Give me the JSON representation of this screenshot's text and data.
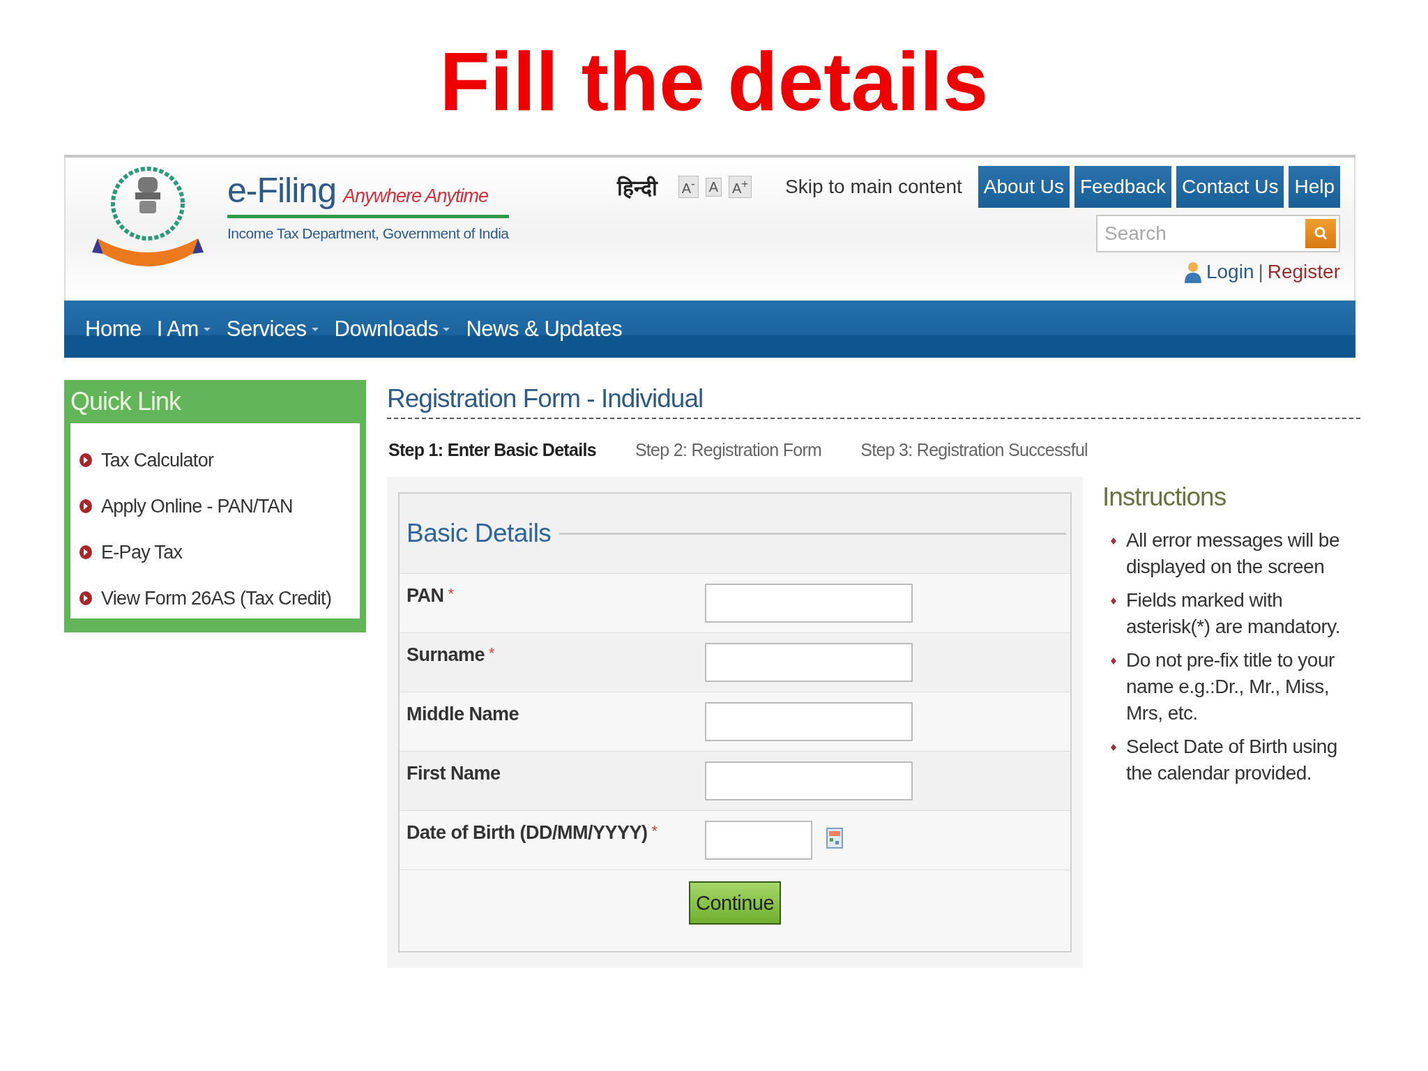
{
  "slide_title": "Fill the details",
  "header": {
    "logo_title": "e-Filing",
    "tagline": "Anywhere Anytime",
    "subtitle": "Income Tax Department, Government of India",
    "language_link": "हिन्दी",
    "font_size_buttons": [
      "A$^{-}$",
      "A",
      "A$^{+}$"
    ],
    "skip_link": "Skip to main content",
    "top_buttons": [
      "About Us",
      "Feedback",
      "Contact Us",
      "Help"
    ],
    "search": {
      "placeholder": "Search"
    },
    "account": {
      "login": "Login",
      "separator": "|",
      "register": "Register"
    }
  },
  "nav": [
    {
      "label": "Home",
      "has_menu": false
    },
    {
      "label": "I Am",
      "has_menu": true
    },
    {
      "label": "Services",
      "has_menu": true
    },
    {
      "label": "Downloads",
      "has_menu": true
    },
    {
      "label": "News & Updates",
      "has_menu": false
    }
  ],
  "quick_link": {
    "title": "Quick Link",
    "items": [
      "Tax Calculator",
      "Apply Online - PAN/TAN",
      "E-Pay Tax",
      "View Form 26AS (Tax Credit)"
    ]
  },
  "registration": {
    "title": "Registration Form - Individual",
    "steps": [
      {
        "label": "Step 1: Enter Basic Details",
        "selected": true
      },
      {
        "label": "Step 2: Registration Form",
        "selected": false
      },
      {
        "label": "Step 3: Registration Successful",
        "selected": false
      }
    ],
    "form": {
      "legend": "Basic Details",
      "fields": [
        {
          "label": "PAN",
          "marker": "*",
          "kind": "text"
        },
        {
          "label": "Surname",
          "marker": "*",
          "kind": "text"
        },
        {
          "label": "Middle Name",
          "kind": "text"
        },
        {
          "label": "First Name",
          "kind": "text"
        },
        {
          "label": "Date of Birth (DD/MM/YYYY)",
          "marker": "*",
          "kind": "date"
        }
      ],
      "submit": "Continue"
    }
  },
  "instructions": {
    "title": "Instructions",
    "items": [
      "All error messages will be displayed on the screen",
      "Fields marked with asterisk(*) are mandatory.",
      "Do not pre-fix title to your name e.g.:Dr., Mr., Miss, Mrs, etc.",
      "Select Date of Birth using the calendar provided."
    ]
  }
}
